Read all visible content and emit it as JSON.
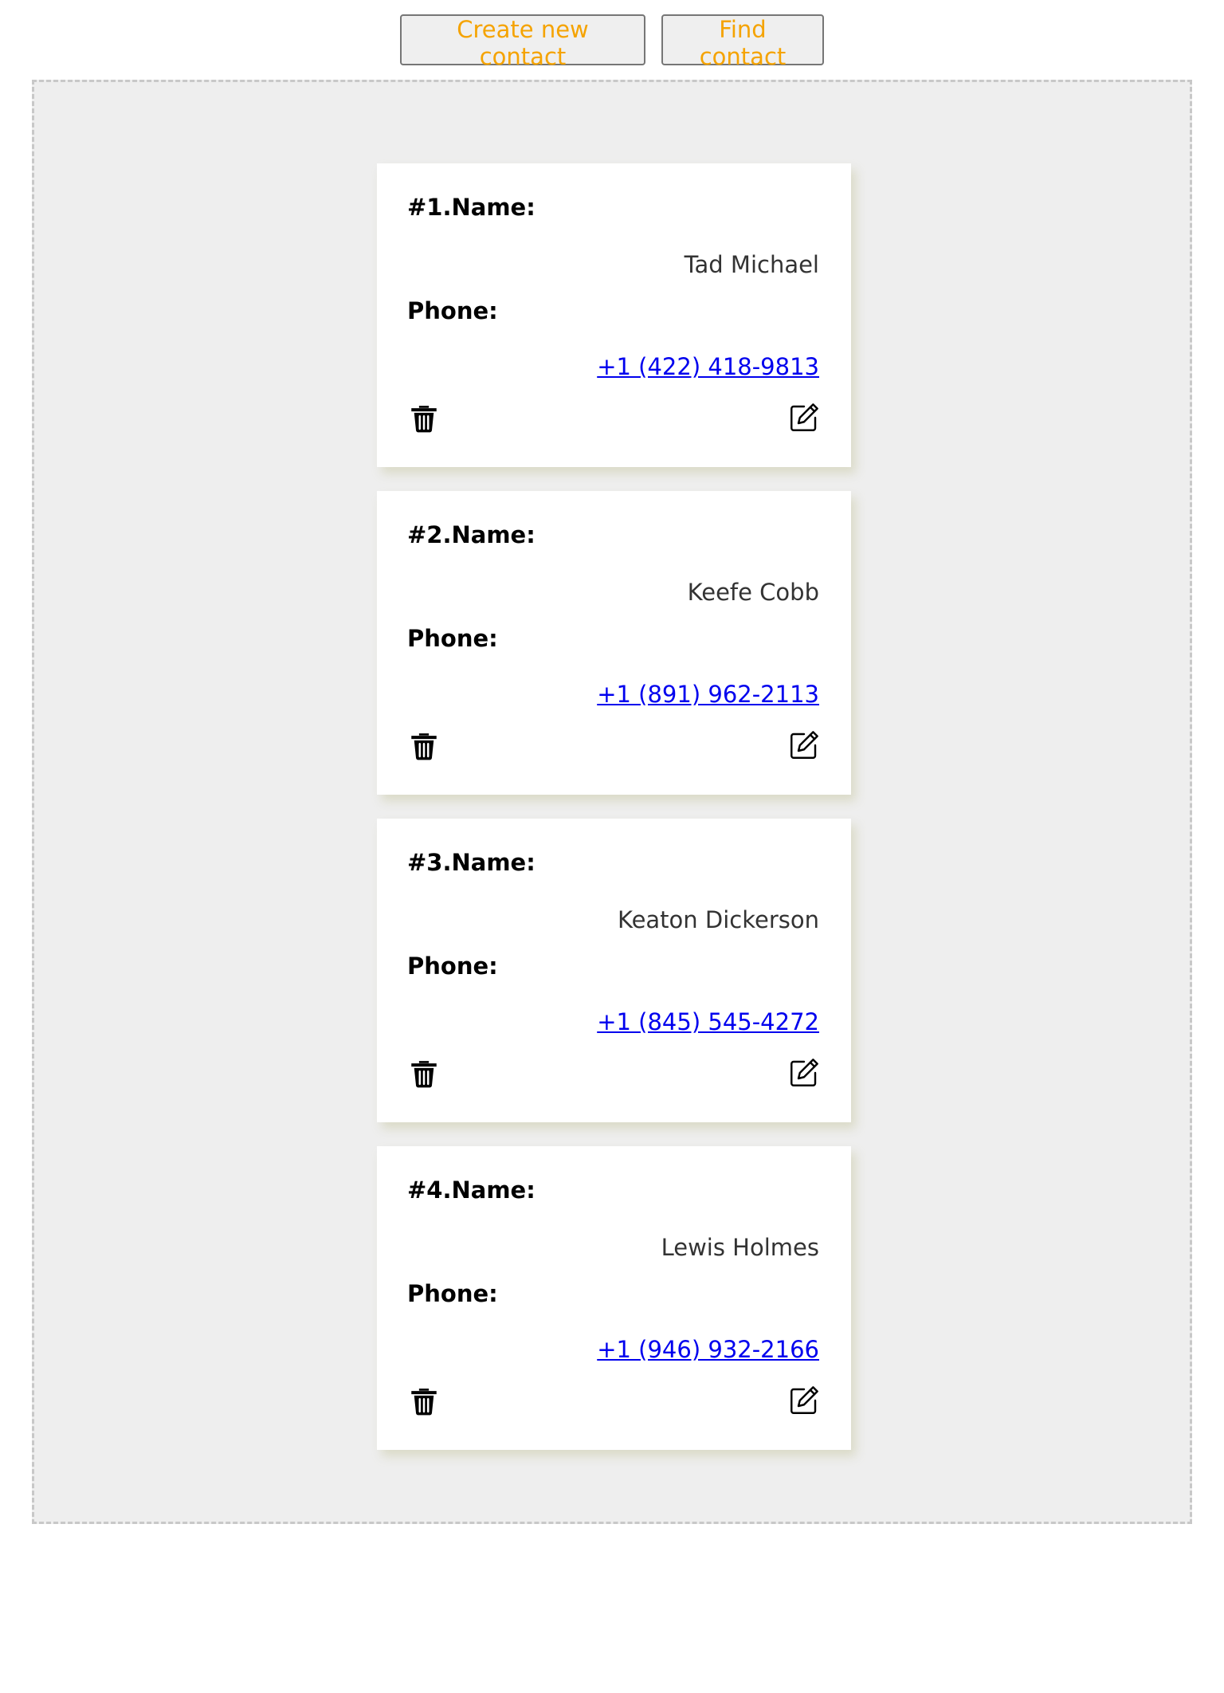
{
  "toolbar": {
    "create_label": "Create new contact",
    "find_label": "Find contact"
  },
  "labels": {
    "phone": "Phone:"
  },
  "contacts": [
    {
      "heading": "#1.Name:",
      "name": "Tad Michael",
      "phone": "+1 (422) 418-9813"
    },
    {
      "heading": "#2.Name:",
      "name": "Keefe Cobb",
      "phone": "+1 (891) 962-2113"
    },
    {
      "heading": "#3.Name:",
      "name": "Keaton Dickerson",
      "phone": "+1 (845) 545-4272"
    },
    {
      "heading": "#4.Name:",
      "name": "Lewis Holmes",
      "phone": "+1 (946) 932-2166"
    }
  ],
  "icons": {
    "delete": "trash-icon",
    "edit": "edit-icon"
  },
  "colors": {
    "button_text": "#f5a300",
    "link": "#0000ee",
    "container_bg": "#eeeeee"
  }
}
